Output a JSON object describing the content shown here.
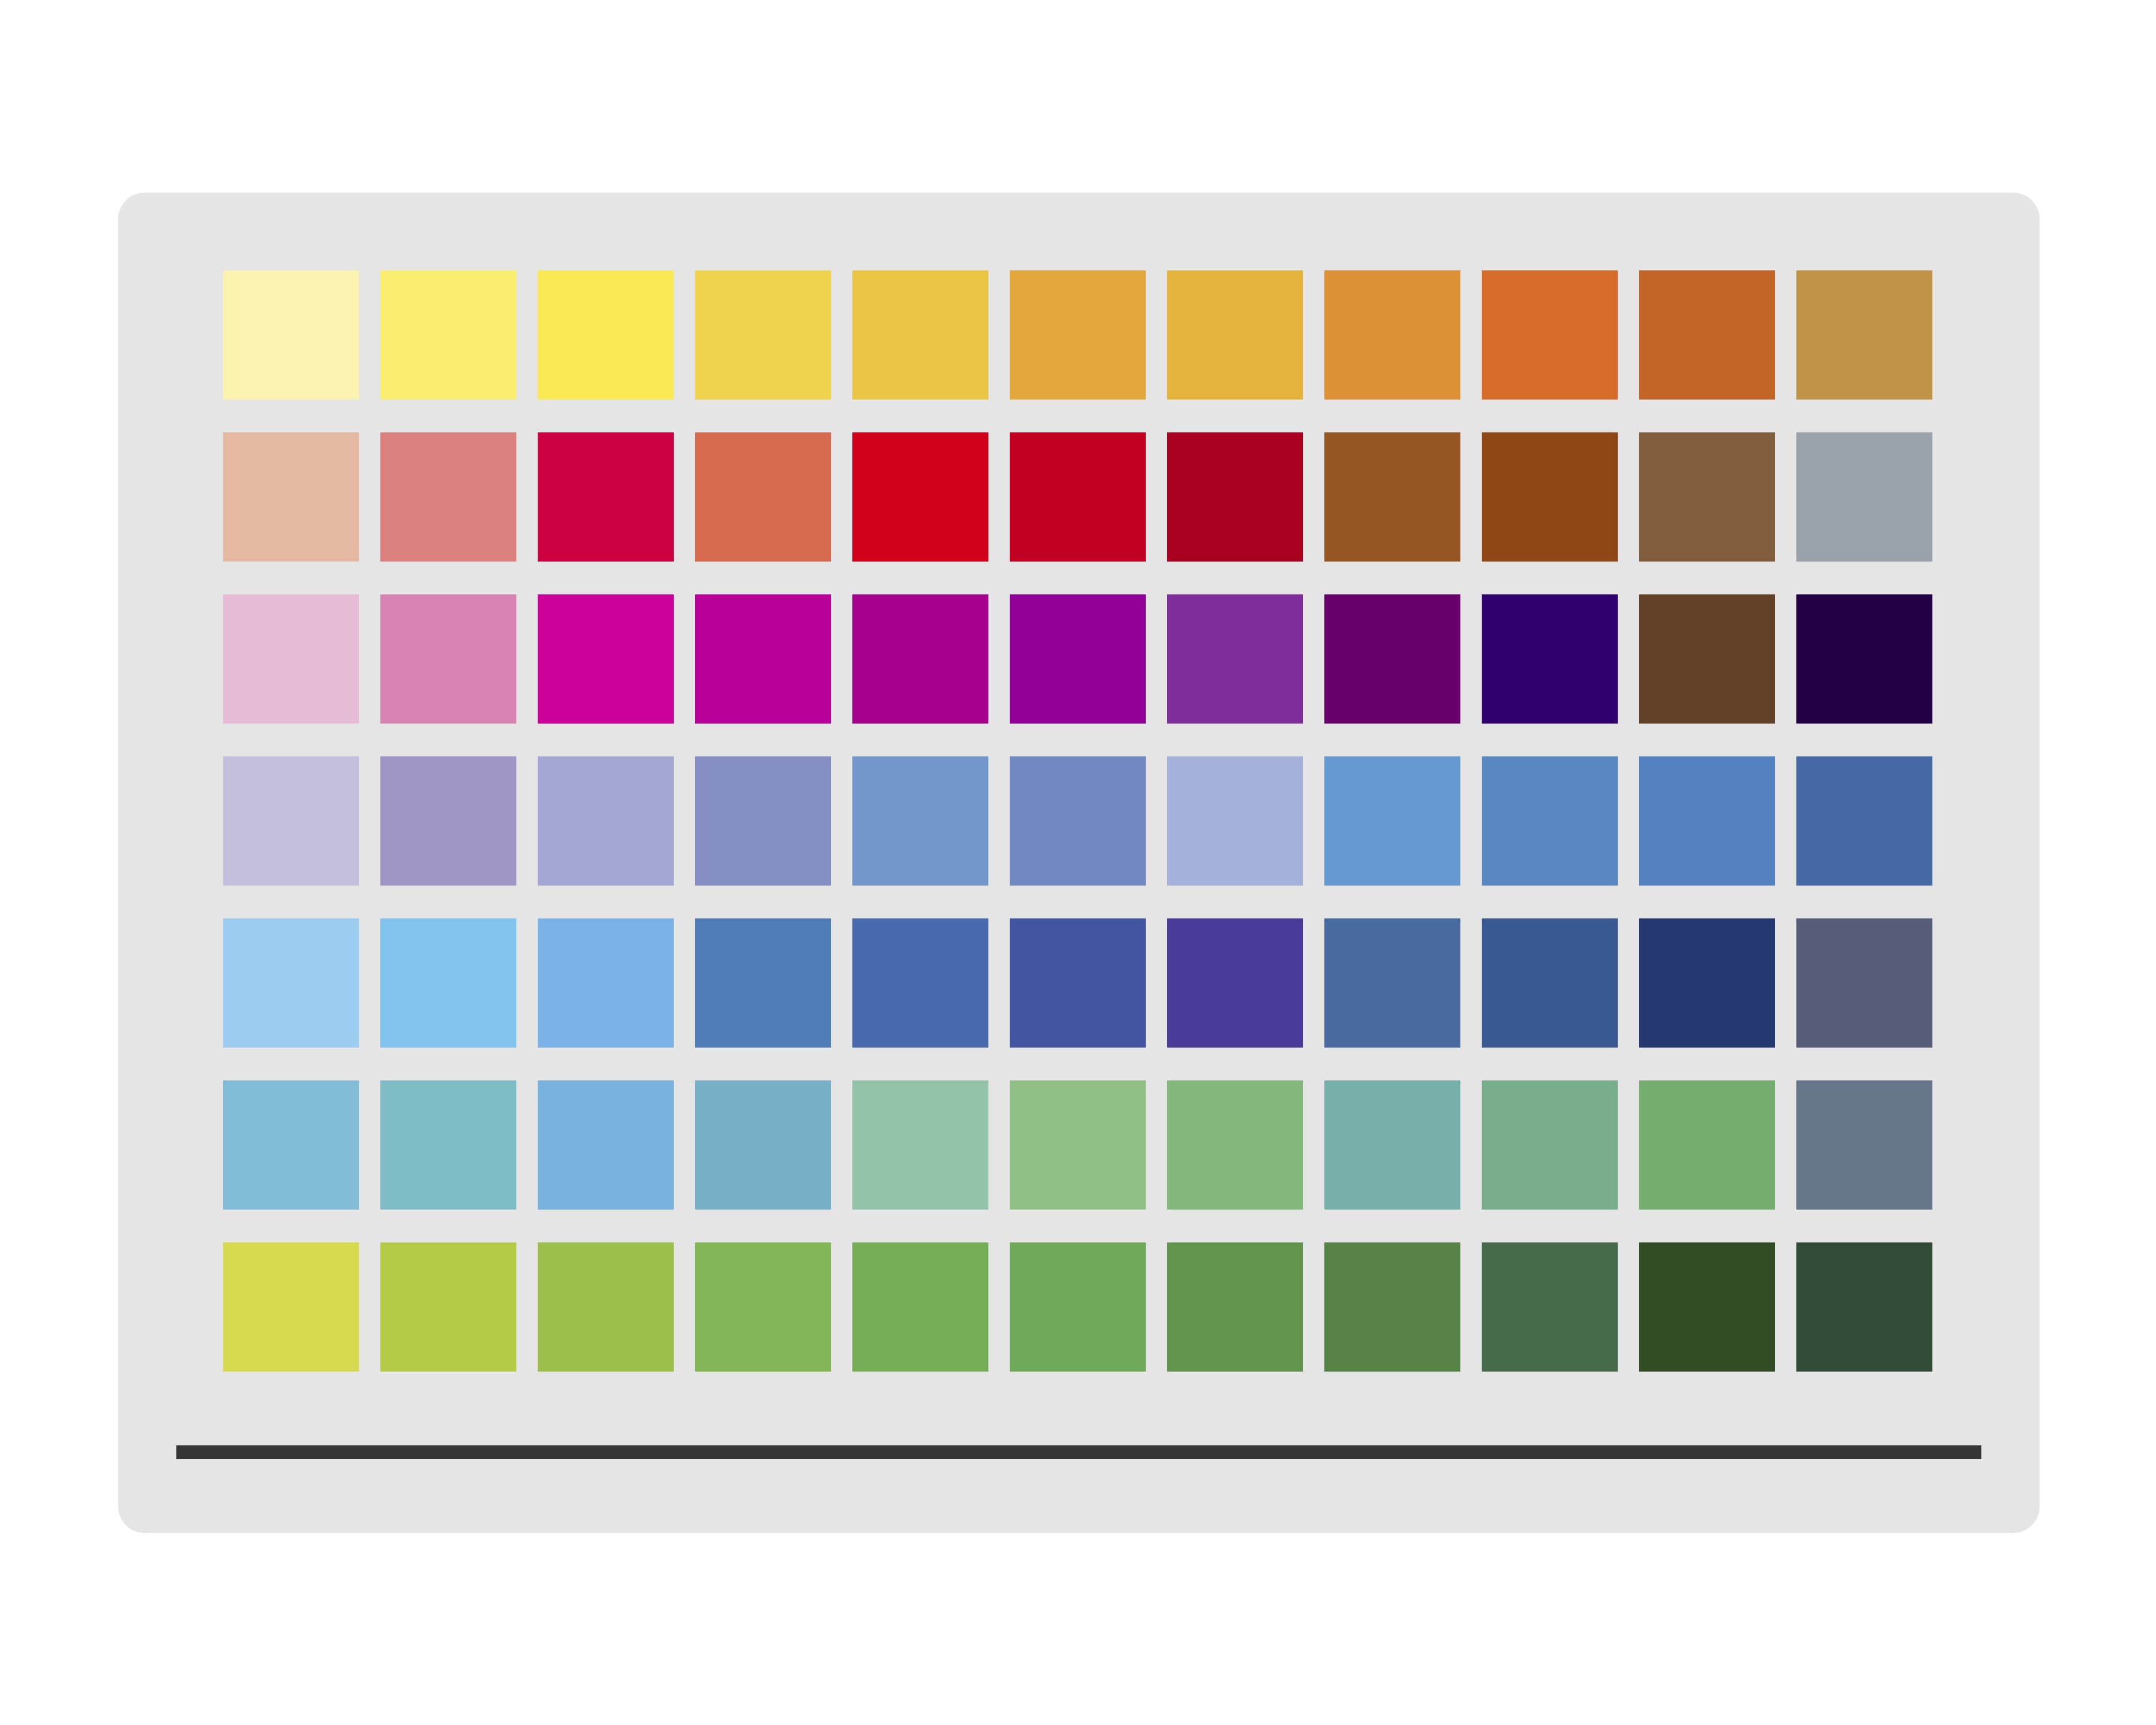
{
  "palette": {
    "rows": [
      [
        "#faf4b0",
        "#f9ee70",
        "#f9e954",
        "#f0d34d",
        "#ebc546",
        "#e3a83d",
        "#e5b43f",
        "#dd9035",
        "#d86c2a",
        "#c36526",
        "#c09346"
      ],
      [
        "#e5b8a2",
        "#da807d",
        "#cd0042",
        "#d56a4e",
        "#d0001b",
        "#c20021",
        "#a8001e",
        "#955624",
        "#8f4715",
        "#805d3d",
        "#99a1ab"
      ],
      [
        "#e5bbd6",
        "#d784b5",
        "#cd0099",
        "#b9009a",
        "#a5008b",
        "#900097",
        "#7f2d9a",
        "#67006a",
        "#31006f",
        "#634128",
        "#230045"
      ],
      [
        "#c3bedb",
        "#a095c5",
        "#a4a6d3",
        "#848ec3",
        "#7497cb",
        "#7189c2",
        "#a6b1db",
        "#6699d1",
        "#5987c2",
        "#5481c0",
        "#4669a5"
      ],
      [
        "#9ccdf0",
        "#82c3ed",
        "#7bb3e9",
        "#507cb8",
        "#4869ae",
        "#4355a0",
        "#483b99",
        "#486a9e",
        "#3a5891",
        "#263870",
        "#575c78"
      ],
      [
        "#82bcd7",
        "#80bcc6",
        "#78b1dc",
        "#77b0c6",
        "#93c4aa",
        "#91c087",
        "#83b77c",
        "#77b0aa",
        "#78ae8c",
        "#75ad6f",
        "#66758a"
      ],
      [
        "#d5d94d",
        "#b3cb46",
        "#9cbf4c",
        "#81b556",
        "#76ae57",
        "#70a95a",
        "#63944e",
        "#568248",
        "#466a4c",
        "#324c24",
        "#324b36"
      ]
    ]
  }
}
